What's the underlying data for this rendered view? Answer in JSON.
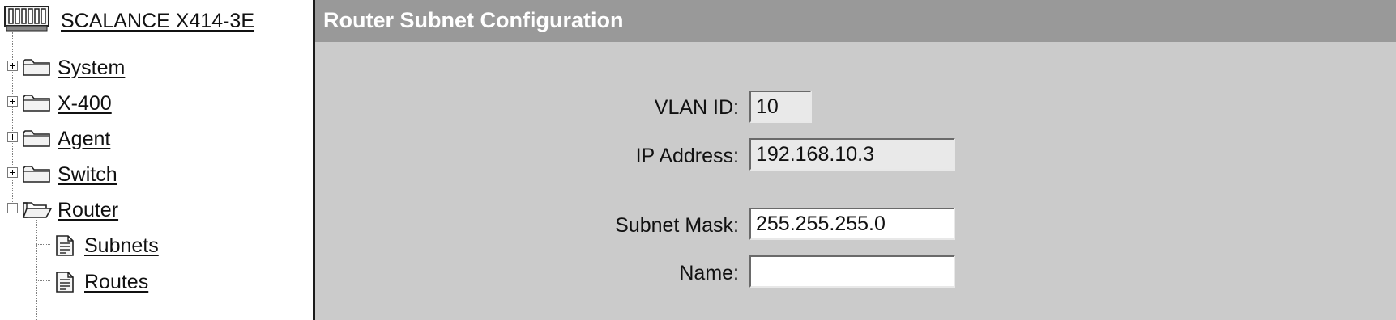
{
  "device": {
    "title": "SCALANCE X414-3E",
    "icon": "device-rack-icon"
  },
  "nav": {
    "items": [
      {
        "label": "System",
        "expanded": false,
        "icon": "folder-icon"
      },
      {
        "label": "X-400",
        "expanded": false,
        "icon": "folder-icon"
      },
      {
        "label": "Agent",
        "expanded": false,
        "icon": "folder-icon"
      },
      {
        "label": "Switch",
        "expanded": false,
        "icon": "folder-icon"
      },
      {
        "label": "Router",
        "expanded": true,
        "icon": "folder-open-icon"
      }
    ],
    "router_children": [
      {
        "label": "Subnets",
        "icon": "document-icon"
      },
      {
        "label": "Routes",
        "icon": "document-icon"
      }
    ]
  },
  "page": {
    "title": "Router Subnet Configuration"
  },
  "form": {
    "vlan_id": {
      "label": "VLAN ID:",
      "value": "10"
    },
    "ip_address": {
      "label": "IP Address:",
      "value": "192.168.10.3"
    },
    "subnet_mask": {
      "label": "Subnet Mask:",
      "value": "255.255.255.0"
    },
    "name": {
      "label": "Name:",
      "value": ""
    }
  },
  "colors": {
    "header_bg": "#999999",
    "content_bg": "#cbcbcb",
    "readonly_field_bg": "#e9e9e9",
    "editable_field_bg": "#ffffff"
  }
}
